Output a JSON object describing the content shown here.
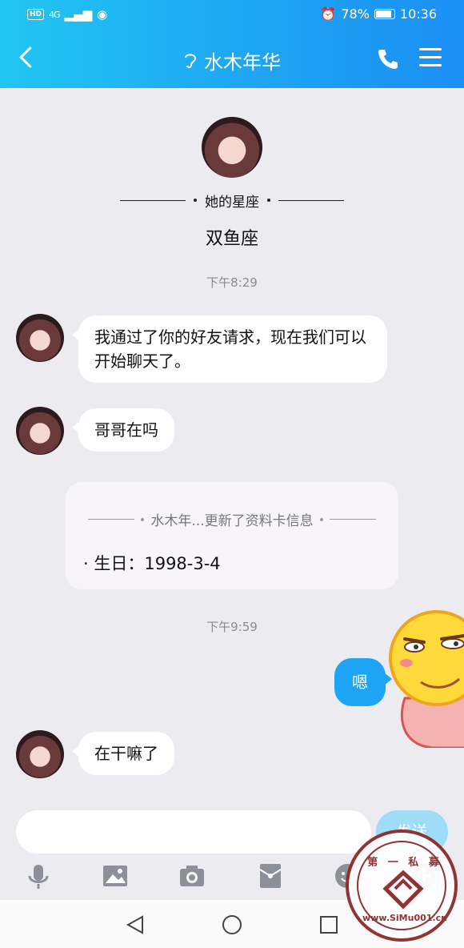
{
  "status": {
    "left_badge": "HD",
    "signal": "4G",
    "battery": "78%",
    "time": "10:36"
  },
  "header": {
    "title": "水木年华"
  },
  "profile": {
    "section_label": "她的星座",
    "value": "双鱼座"
  },
  "messages": {
    "time1": "下午8:29",
    "m1": "我通过了你的好友请求，现在我们可以开始聊天了。",
    "m2": "哥哥在吗",
    "card_head": "水木年...更新了资料卡信息",
    "card_body": "· 生日：1998-3-4",
    "time2": "下午9:59",
    "me1": "嗯",
    "m3": "在干嘛了"
  },
  "input": {
    "send_label": "发送"
  },
  "watermark": {
    "line1": "第 一 私 募",
    "url": "www.SiMu001.cn"
  },
  "colors": {
    "header_start": "#21c6f2",
    "header_end": "#1b8ff5",
    "me_bubble": "#1ea4f5",
    "send_btn": "#9fdcf7"
  }
}
